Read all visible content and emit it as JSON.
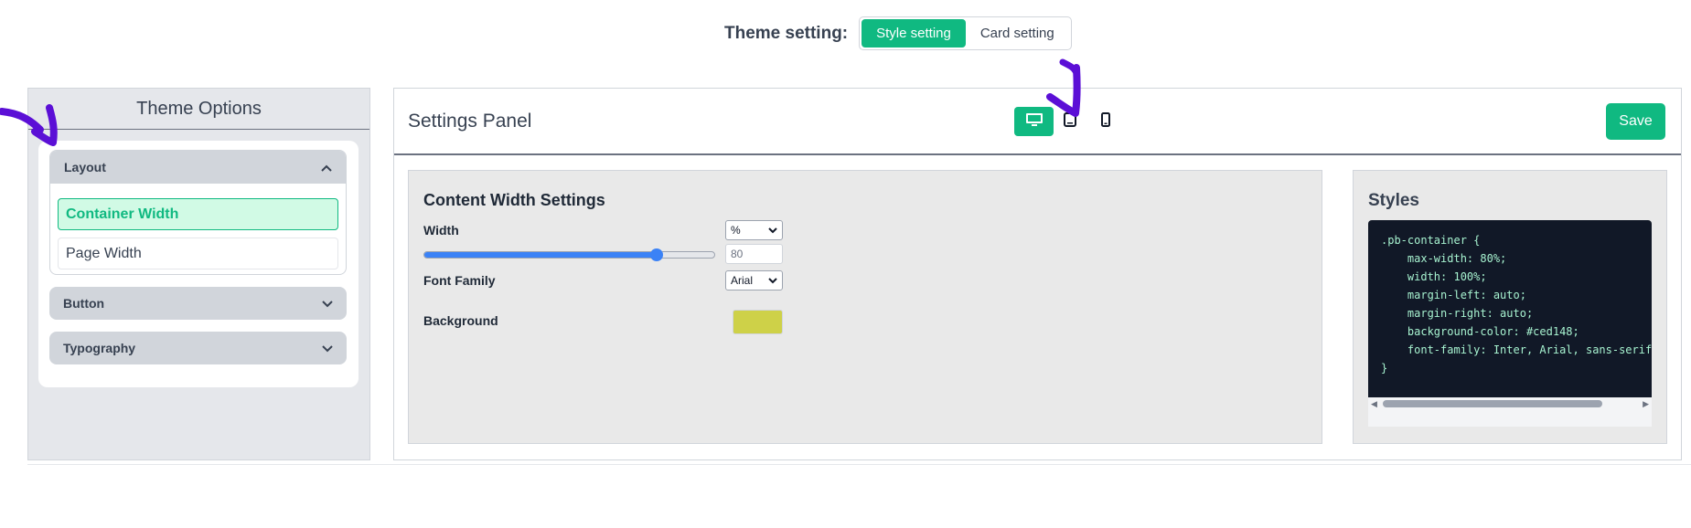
{
  "theme_bar": {
    "label": "Theme setting:",
    "tabs": [
      {
        "label": "Style setting",
        "active": true
      },
      {
        "label": "Card setting",
        "active": false
      }
    ]
  },
  "left_panel": {
    "title": "Theme Options",
    "sections": [
      {
        "label": "Layout",
        "expanded": true,
        "items": [
          "Container Width",
          "Page Width"
        ],
        "active_item": "Container Width"
      },
      {
        "label": "Button",
        "expanded": false
      },
      {
        "label": "Typography",
        "expanded": false
      }
    ]
  },
  "main": {
    "title": "Settings Panel",
    "devices": [
      {
        "icon": "desktop-icon",
        "active": true
      },
      {
        "icon": "tablet-icon",
        "active": false
      },
      {
        "icon": "mobile-icon",
        "active": false
      }
    ],
    "save_label": "Save"
  },
  "content_width": {
    "title": "Content Width Settings",
    "width_label": "Width",
    "unit_value": "%",
    "width_value": "80",
    "slider_fraction": 0.8,
    "font_family_label": "Font Family",
    "font_family_value": "Arial",
    "background_label": "Background",
    "background_color": "#ced148"
  },
  "styles": {
    "title": "Styles",
    "code": ".pb-container {\n    max-width: 80%;\n    width: 100%;\n    margin-left: auto;\n    margin-right: auto;\n    background-color: #ced148;\n    font-family: Inter, Arial, sans-serif;\n}"
  },
  "colors": {
    "accent": "#10b981",
    "slider": "#3b82f6",
    "code_bg": "#111827",
    "arrow": "#5b0fd6"
  }
}
